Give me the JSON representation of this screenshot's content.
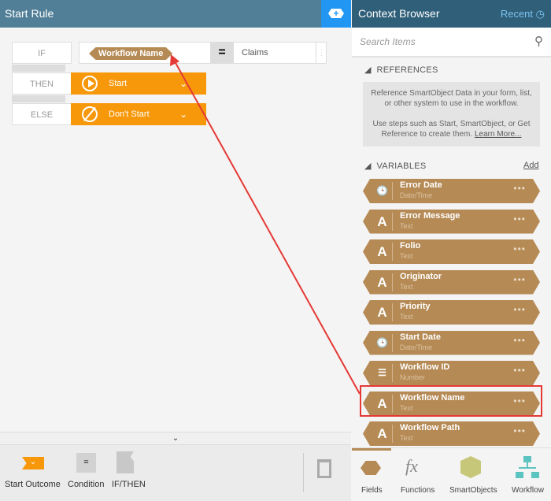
{
  "left": {
    "title": "Start Rule",
    "add_icon": "+",
    "rows": {
      "if_label": "IF",
      "then_label": "THEN",
      "else_label": "ELSE",
      "variable": "Workflow Name",
      "operator": "=",
      "value": "Claims",
      "then_outcome": "Start",
      "else_outcome": "Don't Start"
    }
  },
  "toolbar": {
    "start_outcome": "Start Outcome",
    "condition": "Condition",
    "condition_glyph": "=",
    "ifthen": "IF/THEN"
  },
  "right": {
    "title": "Context Browser",
    "recent": "Recent",
    "search_placeholder": "Search Items",
    "references": {
      "heading": "REFERENCES",
      "text1": "Reference SmartObject Data in your form, list, or other system to use in the workflow.",
      "text2": "Use steps such as Start, SmartObject, or Get Reference to create them.",
      "link": "Learn More..."
    },
    "variables": {
      "heading": "VARIABLES",
      "add": "Add",
      "items": [
        {
          "name": "Error Date",
          "type": "Date/Time",
          "icon": "datetime-icon"
        },
        {
          "name": "Error Message",
          "type": "Text",
          "icon": "text-icon"
        },
        {
          "name": "Folio",
          "type": "Text",
          "icon": "text-icon"
        },
        {
          "name": "Originator",
          "type": "Text",
          "icon": "text-icon"
        },
        {
          "name": "Priority",
          "type": "Text",
          "icon": "text-icon"
        },
        {
          "name": "Start Date",
          "type": "Date/Time",
          "icon": "datetime-icon"
        },
        {
          "name": "Workflow ID",
          "type": "Number",
          "icon": "number-icon"
        },
        {
          "name": "Workflow Name",
          "type": "Text",
          "icon": "text-icon"
        },
        {
          "name": "Workflow Path",
          "type": "Text",
          "icon": "text-icon"
        }
      ]
    }
  },
  "bottom_tabs": [
    "Fields",
    "Functions",
    "SmartObjects",
    "Workflow"
  ],
  "colors": {
    "accent": "#f7980a",
    "variable": "#b58a55",
    "highlight": "#e53935"
  }
}
